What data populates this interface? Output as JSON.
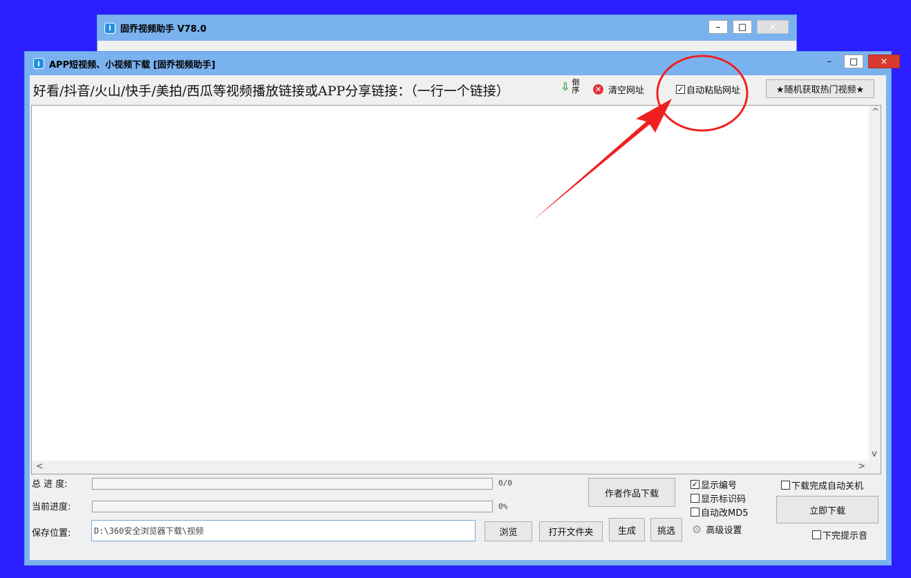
{
  "bg_window": {
    "title": "固乔视频助手 V78.0",
    "icon_letter": "i"
  },
  "main_window": {
    "title": "APP短视频、小视频下载 [固乔视频助手]",
    "icon_letter": "i"
  },
  "window_buttons": {
    "minimize": "–",
    "maximize": "□",
    "close": "×"
  },
  "toolbar": {
    "prompt": "好看/抖音/火山/快手/美拍/西瓜等视频播放链接或APP分享链接：（一行一个链接）",
    "order_label": "倒序",
    "clear_label": "清空网址",
    "auto_paste_label": "自动粘贴网址",
    "auto_paste_checked": true,
    "hot_button": "★随机获取热门视频★"
  },
  "scroll": {
    "up": "^",
    "down": "v",
    "left": "<",
    "right": ">"
  },
  "progress": {
    "total_label": "总 进 度:",
    "total_value": "0/0",
    "total_fraction": 0,
    "current_label": "当前进度:",
    "current_value": "0%",
    "current_fraction": 0
  },
  "save": {
    "label": "保存位置:",
    "path": "D:\\360安全浏览器下载\\视频"
  },
  "buttons": {
    "browse": "浏览",
    "open_folder": "打开文件夹",
    "author_download": "作者作品下载",
    "generate": "生成",
    "pick": "挑选",
    "download_now": "立即下载"
  },
  "options": {
    "show_number": {
      "label": "显示编号",
      "checked": true
    },
    "show_id": {
      "label": "显示标识码",
      "checked": false
    },
    "auto_md5": {
      "label": "自动改MD5",
      "checked": false
    },
    "advanced": "高级设置",
    "auto_shutdown": {
      "label": "下载完成自动关机",
      "checked": false
    },
    "done_sound": {
      "label": "下完提示音",
      "checked": false
    }
  },
  "colors": {
    "annotation": "#f02020",
    "desktop": "#2b1fff",
    "titlebar": "#7ab2ef"
  }
}
